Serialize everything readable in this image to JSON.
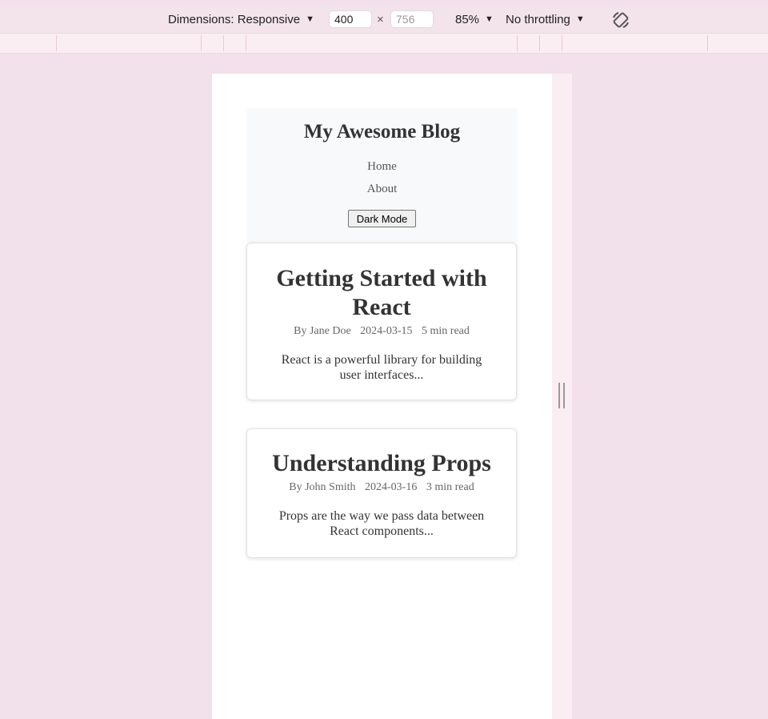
{
  "toolbar": {
    "dimensions_label": "Dimensions: Responsive",
    "width_value": "400",
    "height_placeholder": "756",
    "times": "×",
    "zoom_label": "85%",
    "throttle_label": "No throttling",
    "caret": "▼"
  },
  "blog": {
    "title": "My Awesome Blog",
    "nav": [
      "Home",
      "About"
    ],
    "dark_mode_label": "Dark Mode"
  },
  "posts": [
    {
      "title": "Getting Started with React",
      "author": "By Jane Doe",
      "date": "2024-03-15",
      "read_time": "5 min read",
      "excerpt": "React is a powerful library for building user interfaces..."
    },
    {
      "title": "Understanding Props",
      "author": "By John Smith",
      "date": "2024-03-16",
      "read_time": "3 min read",
      "excerpt": "Props are the way we pass data between React components..."
    }
  ]
}
